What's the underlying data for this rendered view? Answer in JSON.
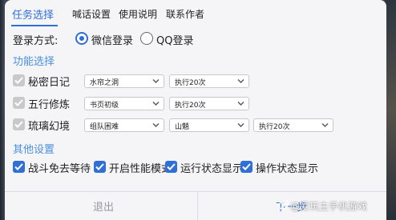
{
  "tabs": [
    "任务选择",
    "喊话设置",
    "使用说明",
    "联系作者"
  ],
  "login": {
    "label": "登录方式:",
    "options": [
      "微信登录",
      "QQ登录"
    ],
    "selected": "微信登录"
  },
  "sections": {
    "functions": "功能选择",
    "other": "其他设置"
  },
  "features": [
    {
      "label": "秘密日记",
      "enabled": false,
      "selects": [
        "水帘之洞",
        "执行20次"
      ]
    },
    {
      "label": "五行修炼",
      "enabled": false,
      "selects": [
        "书页初级",
        "执行20次"
      ]
    },
    {
      "label": "琉璃幻境",
      "enabled": false,
      "selects": [
        "组队困难",
        "山魈",
        "执行20次"
      ]
    }
  ],
  "other_settings": [
    {
      "label": "战斗免去等待",
      "checked": true
    },
    {
      "label": "开启性能模式",
      "checked": true
    },
    {
      "label": "运行状态显示",
      "checked": true
    },
    {
      "label": "操作状态显示",
      "checked": true
    }
  ],
  "footer": {
    "exit": "退出",
    "next": "下一步"
  },
  "watermark": "@爱玩主手机游戏",
  "colors": {
    "accent": "#2f6fd6",
    "section": "#4a8fe0",
    "disabled_checkbox": "#c9c9cc"
  }
}
